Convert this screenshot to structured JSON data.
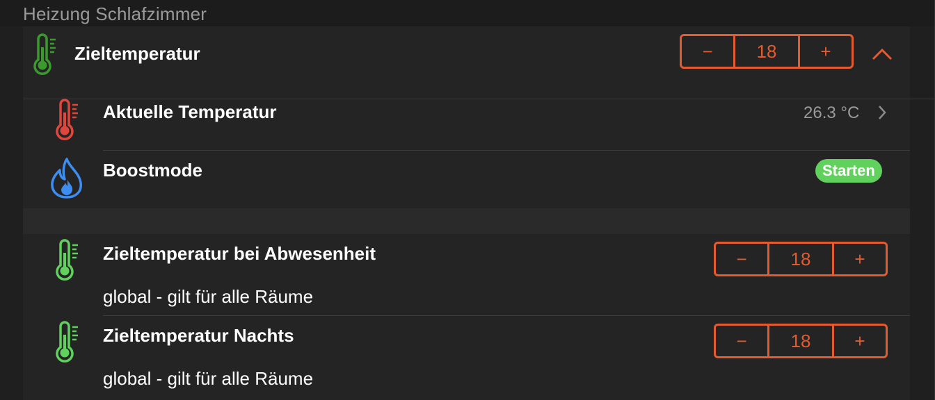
{
  "section": {
    "title": "Heizung Schlafzimmer"
  },
  "colors": {
    "accent": "#e35b2e",
    "green": "#5fd15c",
    "red": "#e0473c",
    "blue": "#3d8ef0",
    "dark_green": "#3a9a2e"
  },
  "rows": {
    "zieltemp": {
      "icon": "thermometer-icon",
      "label": "Zieltemperatur",
      "value": "18",
      "minus": "−",
      "plus": "+"
    },
    "aktuell": {
      "icon": "thermometer-icon",
      "label": "Aktuelle Temperatur",
      "value": "26.3 °C"
    },
    "boost": {
      "icon": "flame-icon",
      "label": "Boostmode",
      "button": "Starten"
    },
    "abwesenheit": {
      "icon": "thermometer-icon",
      "label": "Zieltemperatur bei Abwesenheit",
      "sublabel": "global - gilt für alle Räume",
      "value": "18",
      "minus": "−",
      "plus": "+"
    },
    "nachts": {
      "icon": "thermometer-icon",
      "label": "Zieltemperatur Nachts",
      "sublabel": "global - gilt für alle Räume",
      "value": "18",
      "minus": "−",
      "plus": "+"
    }
  }
}
